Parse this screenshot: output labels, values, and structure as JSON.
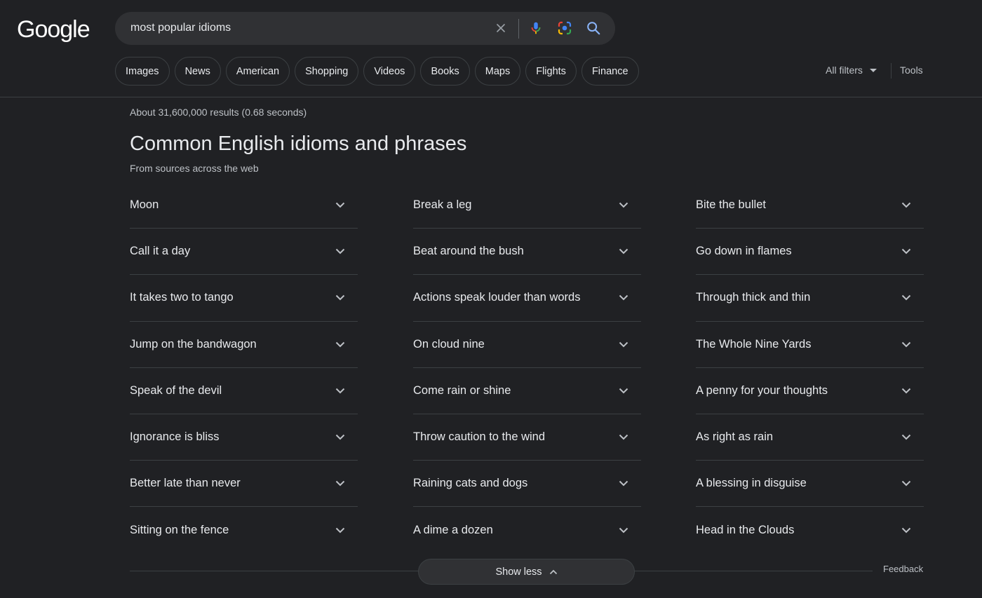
{
  "brand": {
    "logo_text": "Google"
  },
  "search": {
    "query": "most popular idioms"
  },
  "chips": [
    "Images",
    "News",
    "American",
    "Shopping",
    "Videos",
    "Books",
    "Maps",
    "Flights",
    "Finance"
  ],
  "filters": {
    "all_filters_label": "All filters",
    "tools_label": "Tools"
  },
  "stats": "About 31,600,000 results (0.68 seconds)",
  "section": {
    "title": "Common English idioms and phrases",
    "subtitle": "From sources across the web",
    "columns": [
      [
        "Moon",
        "Call it a day",
        "It takes two to tango",
        "Jump on the bandwagon",
        "Speak of the devil",
        "Ignorance is bliss",
        "Better late than never",
        "Sitting on the fence"
      ],
      [
        "Break a leg",
        "Beat around the bush",
        "Actions speak louder than words",
        "On cloud nine",
        "Come rain or shine",
        "Throw caution to the wind",
        "Raining cats and dogs",
        "A dime a dozen"
      ],
      [
        "Bite the bullet",
        "Go down in flames",
        "Through thick and thin",
        "The Whole Nine Yards",
        "A penny for your thoughts",
        "As right as rain",
        "A blessing in disguise",
        "Head in the Clouds"
      ]
    ]
  },
  "footer": {
    "show_less_label": "Show less",
    "feedback_label": "Feedback"
  },
  "icons": {
    "clear": "close-icon",
    "voice": "microphone-icon",
    "lens": "camera-lens-icon",
    "search": "search-icon",
    "expand": "chevron-down-icon",
    "collapse": "chevron-up-icon",
    "filters": "caret-down-icon"
  },
  "colors": {
    "background": "#202124",
    "surface": "#303134",
    "divider": "#3c4043",
    "text_primary": "#e8eaed",
    "text_secondary": "#bdc1c6",
    "accent_blue": "#8ab4f8"
  }
}
